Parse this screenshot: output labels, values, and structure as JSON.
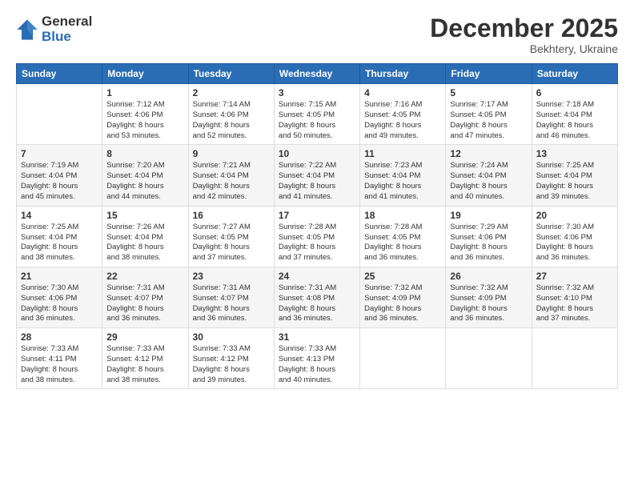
{
  "logo": {
    "general": "General",
    "blue": "Blue"
  },
  "title": "December 2025",
  "location": "Bekhtery, Ukraine",
  "days_header": [
    "Sunday",
    "Monday",
    "Tuesday",
    "Wednesday",
    "Thursday",
    "Friday",
    "Saturday"
  ],
  "weeks": [
    [
      {
        "day": "",
        "info": ""
      },
      {
        "day": "1",
        "info": "Sunrise: 7:12 AM\nSunset: 4:06 PM\nDaylight: 8 hours\nand 53 minutes."
      },
      {
        "day": "2",
        "info": "Sunrise: 7:14 AM\nSunset: 4:06 PM\nDaylight: 8 hours\nand 52 minutes."
      },
      {
        "day": "3",
        "info": "Sunrise: 7:15 AM\nSunset: 4:05 PM\nDaylight: 8 hours\nand 50 minutes."
      },
      {
        "day": "4",
        "info": "Sunrise: 7:16 AM\nSunset: 4:05 PM\nDaylight: 8 hours\nand 49 minutes."
      },
      {
        "day": "5",
        "info": "Sunrise: 7:17 AM\nSunset: 4:05 PM\nDaylight: 8 hours\nand 47 minutes."
      },
      {
        "day": "6",
        "info": "Sunrise: 7:18 AM\nSunset: 4:04 PM\nDaylight: 8 hours\nand 46 minutes."
      }
    ],
    [
      {
        "day": "7",
        "info": "Sunrise: 7:19 AM\nSunset: 4:04 PM\nDaylight: 8 hours\nand 45 minutes."
      },
      {
        "day": "8",
        "info": "Sunrise: 7:20 AM\nSunset: 4:04 PM\nDaylight: 8 hours\nand 44 minutes."
      },
      {
        "day": "9",
        "info": "Sunrise: 7:21 AM\nSunset: 4:04 PM\nDaylight: 8 hours\nand 42 minutes."
      },
      {
        "day": "10",
        "info": "Sunrise: 7:22 AM\nSunset: 4:04 PM\nDaylight: 8 hours\nand 41 minutes."
      },
      {
        "day": "11",
        "info": "Sunrise: 7:23 AM\nSunset: 4:04 PM\nDaylight: 8 hours\nand 41 minutes."
      },
      {
        "day": "12",
        "info": "Sunrise: 7:24 AM\nSunset: 4:04 PM\nDaylight: 8 hours\nand 40 minutes."
      },
      {
        "day": "13",
        "info": "Sunrise: 7:25 AM\nSunset: 4:04 PM\nDaylight: 8 hours\nand 39 minutes."
      }
    ],
    [
      {
        "day": "14",
        "info": "Sunrise: 7:25 AM\nSunset: 4:04 PM\nDaylight: 8 hours\nand 38 minutes."
      },
      {
        "day": "15",
        "info": "Sunrise: 7:26 AM\nSunset: 4:04 PM\nDaylight: 8 hours\nand 38 minutes."
      },
      {
        "day": "16",
        "info": "Sunrise: 7:27 AM\nSunset: 4:05 PM\nDaylight: 8 hours\nand 37 minutes."
      },
      {
        "day": "17",
        "info": "Sunrise: 7:28 AM\nSunset: 4:05 PM\nDaylight: 8 hours\nand 37 minutes."
      },
      {
        "day": "18",
        "info": "Sunrise: 7:28 AM\nSunset: 4:05 PM\nDaylight: 8 hours\nand 36 minutes."
      },
      {
        "day": "19",
        "info": "Sunrise: 7:29 AM\nSunset: 4:06 PM\nDaylight: 8 hours\nand 36 minutes."
      },
      {
        "day": "20",
        "info": "Sunrise: 7:30 AM\nSunset: 4:06 PM\nDaylight: 8 hours\nand 36 minutes."
      }
    ],
    [
      {
        "day": "21",
        "info": "Sunrise: 7:30 AM\nSunset: 4:06 PM\nDaylight: 8 hours\nand 36 minutes."
      },
      {
        "day": "22",
        "info": "Sunrise: 7:31 AM\nSunset: 4:07 PM\nDaylight: 8 hours\nand 36 minutes."
      },
      {
        "day": "23",
        "info": "Sunrise: 7:31 AM\nSunset: 4:07 PM\nDaylight: 8 hours\nand 36 minutes."
      },
      {
        "day": "24",
        "info": "Sunrise: 7:31 AM\nSunset: 4:08 PM\nDaylight: 8 hours\nand 36 minutes."
      },
      {
        "day": "25",
        "info": "Sunrise: 7:32 AM\nSunset: 4:09 PM\nDaylight: 8 hours\nand 36 minutes."
      },
      {
        "day": "26",
        "info": "Sunrise: 7:32 AM\nSunset: 4:09 PM\nDaylight: 8 hours\nand 36 minutes."
      },
      {
        "day": "27",
        "info": "Sunrise: 7:32 AM\nSunset: 4:10 PM\nDaylight: 8 hours\nand 37 minutes."
      }
    ],
    [
      {
        "day": "28",
        "info": "Sunrise: 7:33 AM\nSunset: 4:11 PM\nDaylight: 8 hours\nand 38 minutes."
      },
      {
        "day": "29",
        "info": "Sunrise: 7:33 AM\nSunset: 4:12 PM\nDaylight: 8 hours\nand 38 minutes."
      },
      {
        "day": "30",
        "info": "Sunrise: 7:33 AM\nSunset: 4:12 PM\nDaylight: 8 hours\nand 39 minutes."
      },
      {
        "day": "31",
        "info": "Sunrise: 7:33 AM\nSunset: 4:13 PM\nDaylight: 8 hours\nand 40 minutes."
      },
      {
        "day": "",
        "info": ""
      },
      {
        "day": "",
        "info": ""
      },
      {
        "day": "",
        "info": ""
      }
    ]
  ]
}
